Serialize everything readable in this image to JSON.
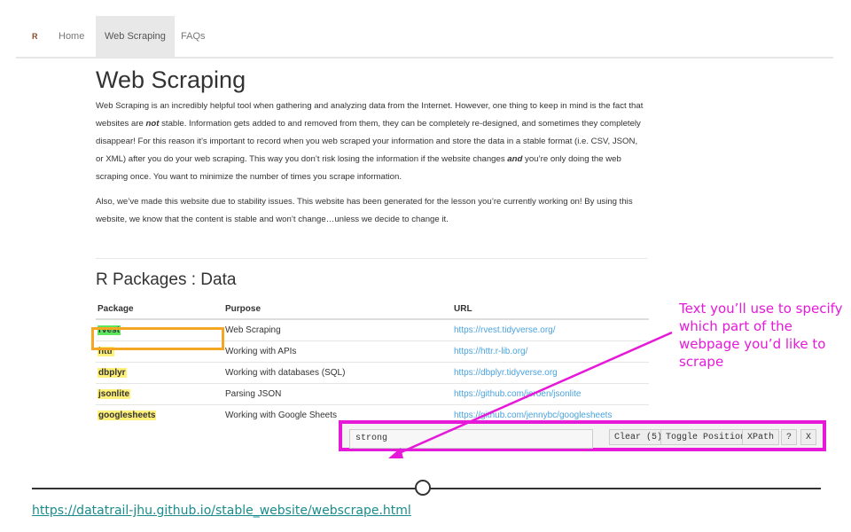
{
  "navbar": {
    "brand": "R",
    "items": [
      {
        "label": "Home",
        "active": false
      },
      {
        "label": "Web Scraping",
        "active": true
      },
      {
        "label": "FAQs",
        "active": false
      }
    ]
  },
  "page": {
    "title": "Web Scraping",
    "para1_a": "Web Scraping is an incredibly helpful tool when gathering and analyzing data from the Internet. However, one thing to keep in mind is the fact that websites are ",
    "para1_em1": "not",
    "para1_b": " stable. Information gets added to and removed from them, they can be completely re-designed, and sometimes they completely disappear! For this reason it’s important to record when you web scraped your information and store the data in a stable format (i.e. CSV, JSON, or XML) after you do your web scraping. This way you don’t risk losing the information if the website changes ",
    "para1_em2": "and",
    "para1_c": " you’re only doing the web scraping once. You want to minimize the number of times you scrape information.",
    "para2": "Also, we’ve made this website due to stability issues. This website has been generated for the lesson you’re currently working on! By using this website, we know that the content is stable and won’t change…unless we decide to change it.",
    "section_title": "R Packages : Data",
    "table": {
      "headers": [
        "Package",
        "Purpose",
        "URL"
      ],
      "rows": [
        {
          "package": "rvest",
          "purpose": "Web Scraping",
          "url": "https://rvest.tidyverse.org/"
        },
        {
          "package": "httr",
          "purpose": "Working with APIs",
          "url": "https://httr.r-lib.org/"
        },
        {
          "package": "dbplyr",
          "purpose": "Working with databases (SQL)",
          "url": "https://dbplyr.tidyverse.org"
        },
        {
          "package": "jsonlite",
          "purpose": "Parsing JSON",
          "url": "https://github.com/jeroen/jsonlite"
        },
        {
          "package": "googlesheets",
          "purpose": "Working with Google Sheets",
          "url": "https://github.com/jennybc/googlesheets"
        }
      ]
    }
  },
  "selector_gadget": {
    "input_value": "strong",
    "clear_label": "Clear (5)",
    "toggle_label": "Toggle Position",
    "xpath_label": "XPath",
    "help_label": "?",
    "close_label": "X"
  },
  "annotation": {
    "text": "Text you’ll use to specify which part of the webpage you’d like to scrape"
  },
  "source_link": "https://datatrail-jhu.github.io/stable_website/webscrape.html",
  "colors": {
    "annotation": "#e619d9",
    "selected_outline": "#f5a623",
    "highlight_yellow": "#fff07a",
    "highlight_green": "#5ee65e",
    "link": "#4aa3df"
  }
}
